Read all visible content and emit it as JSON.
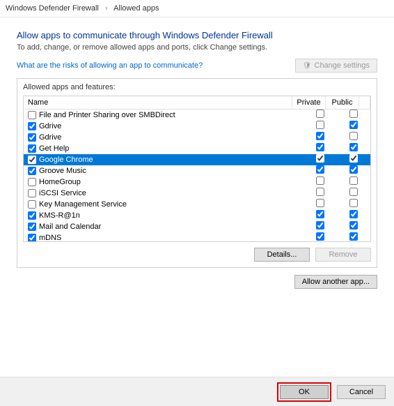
{
  "breadcrumb": {
    "parent": "Windows Defender Firewall",
    "current": "Allowed apps"
  },
  "heading": "Allow apps to communicate through Windows Defender Firewall",
  "subtext": "To add, change, or remove allowed apps and ports, click Change settings.",
  "risk_link": "What are the risks of allowing an app to communicate?",
  "change_settings": "Change settings",
  "group_label": "Allowed apps and features:",
  "columns": {
    "name": "Name",
    "private": "Private",
    "public": "Public"
  },
  "apps": [
    {
      "enabled": false,
      "name": "File and Printer Sharing over SMBDirect",
      "private": false,
      "public": false,
      "selected": false
    },
    {
      "enabled": true,
      "name": "Gdrive",
      "private": false,
      "public": true,
      "selected": false
    },
    {
      "enabled": true,
      "name": "Gdrive",
      "private": true,
      "public": false,
      "selected": false
    },
    {
      "enabled": true,
      "name": "Get Help",
      "private": true,
      "public": true,
      "selected": false
    },
    {
      "enabled": true,
      "name": "Google Chrome",
      "private": true,
      "public": true,
      "selected": true
    },
    {
      "enabled": true,
      "name": "Groove Music",
      "private": true,
      "public": true,
      "selected": false
    },
    {
      "enabled": false,
      "name": "HomeGroup",
      "private": false,
      "public": false,
      "selected": false
    },
    {
      "enabled": false,
      "name": "iSCSI Service",
      "private": false,
      "public": false,
      "selected": false
    },
    {
      "enabled": false,
      "name": "Key Management Service",
      "private": false,
      "public": false,
      "selected": false
    },
    {
      "enabled": true,
      "name": "KMS-R@1n",
      "private": true,
      "public": true,
      "selected": false
    },
    {
      "enabled": true,
      "name": "Mail and Calendar",
      "private": true,
      "public": true,
      "selected": false
    },
    {
      "enabled": true,
      "name": "mDNS",
      "private": true,
      "public": true,
      "selected": false
    }
  ],
  "buttons": {
    "details": "Details...",
    "remove": "Remove",
    "allow_another": "Allow another app...",
    "ok": "OK",
    "cancel": "Cancel"
  }
}
